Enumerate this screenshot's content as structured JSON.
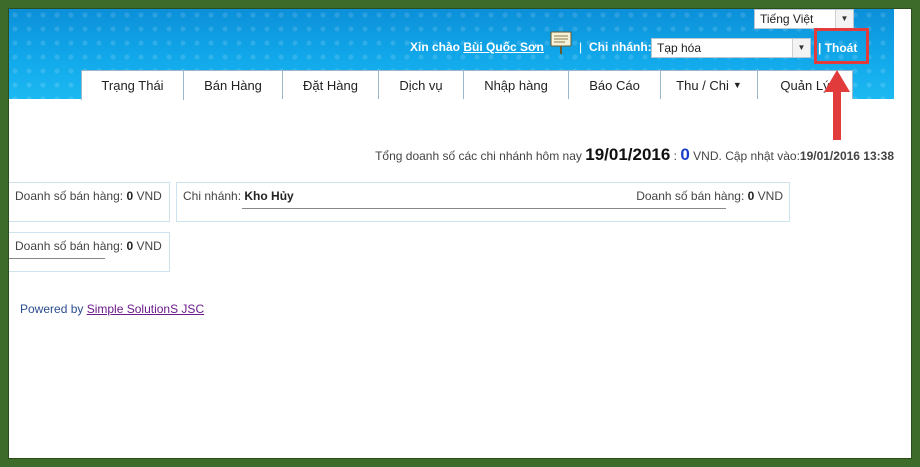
{
  "header": {
    "language": "Tiếng Việt",
    "greeting_prefix": "Xin chào",
    "user_name": "Bùi Quốc Sơn",
    "separator": "|",
    "branch_label": "Chi nhánh:",
    "branch_value": "Tạp hóa",
    "logout": "| Thoát"
  },
  "tabs": [
    {
      "label": "Trạng Thái"
    },
    {
      "label": "Bán Hàng"
    },
    {
      "label": "Đặt Hàng"
    },
    {
      "label": "Dịch vụ"
    },
    {
      "label": "Nhập hàng"
    },
    {
      "label": "Báo Cáo"
    },
    {
      "label": "Thu / Chi"
    },
    {
      "label": "Quản Lý"
    }
  ],
  "summary": {
    "prefix": "Tổng doanh số các chi nhánh hôm nay",
    "date": "19/01/2016",
    "colon": ":",
    "amount": "0",
    "currency": "VND.",
    "update_label": "Cập nhật vào:",
    "update_time": "19/01/2016 13:38"
  },
  "cards": {
    "card1": {
      "sales_label": "Doanh số bán hàng:",
      "sales_value": "0",
      "currency": "VND"
    },
    "card2": {
      "branch_label": "Chi nhánh:",
      "branch_value": "Kho Hủy",
      "sales_label": "Doanh số bán hàng:",
      "sales_value": "0",
      "currency": "VND"
    },
    "card3": {
      "sales_label": "Doanh số bán hàng:",
      "sales_value": "0",
      "currency": "VND"
    }
  },
  "footer": {
    "powered_by": "Powered by",
    "company": "Simple SolutionS JSC"
  },
  "colors": {
    "header_blue": "#11a8ea",
    "highlight_red": "#e23b3b",
    "frame_green": "#3d6b2a",
    "amount_blue": "#1a3ec9"
  }
}
